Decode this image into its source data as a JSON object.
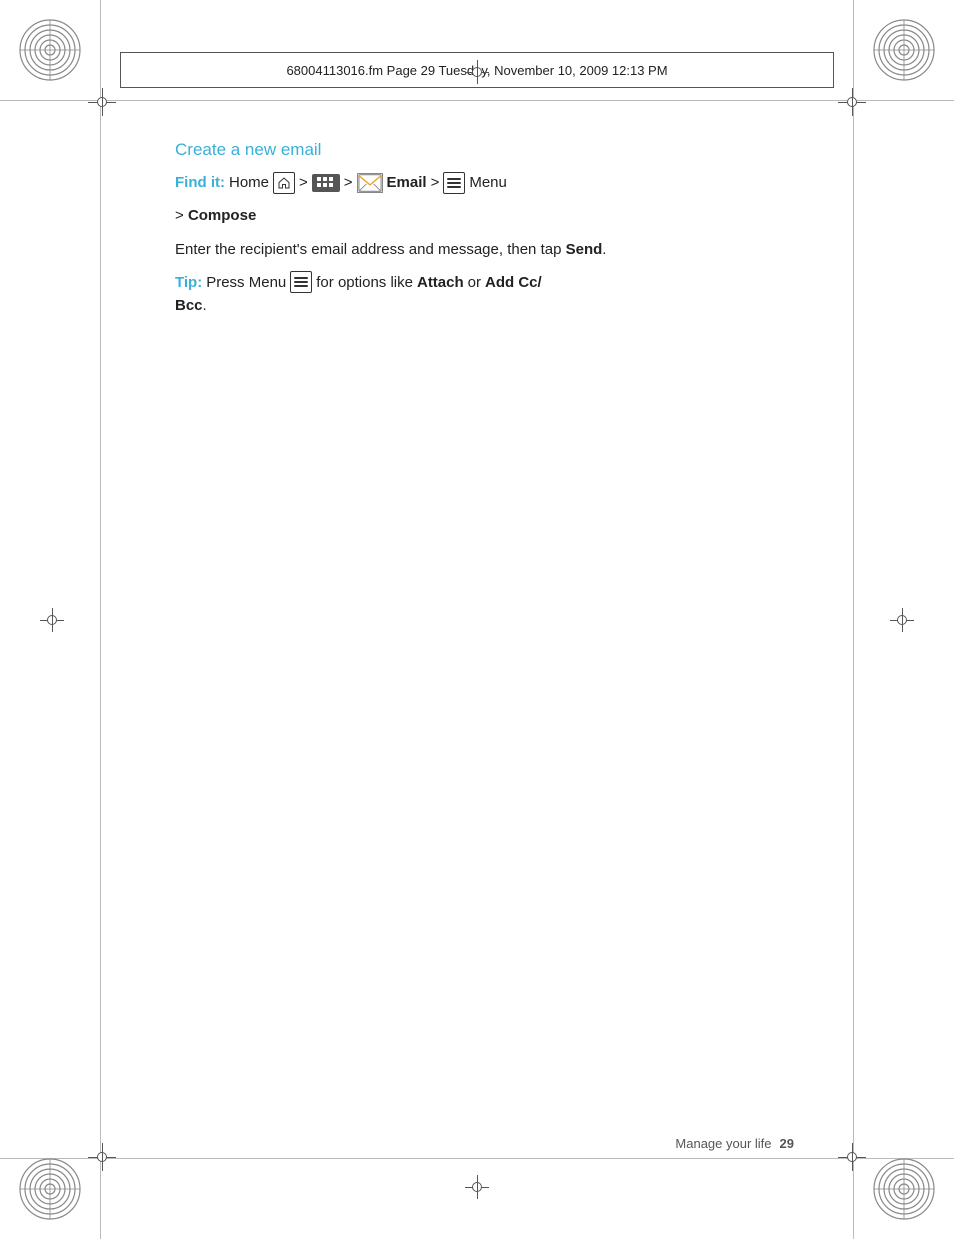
{
  "header": {
    "file_info": "68004113016.fm  Page 29  Tuesday, November 10, 2009  12:13 PM"
  },
  "content": {
    "section_title": "Create a new email",
    "find_it": {
      "label": "Find it:",
      "steps": [
        "Home",
        ">",
        ">",
        "Email",
        ">",
        "Menu",
        ">",
        "Compose"
      ]
    },
    "description": "Enter the recipient's email address and message, then tap Send.",
    "tip": {
      "label": "Tip:",
      "text": "Press Menu",
      "suffix": "for options like",
      "bold1": "Attach",
      "or": "or",
      "bold2": "Add Cc/Bcc",
      "end": "."
    }
  },
  "footer": {
    "section_label": "Manage your life",
    "page_number": "29"
  },
  "colors": {
    "accent": "#3ab0d8",
    "text": "#222222",
    "muted": "#555555"
  }
}
